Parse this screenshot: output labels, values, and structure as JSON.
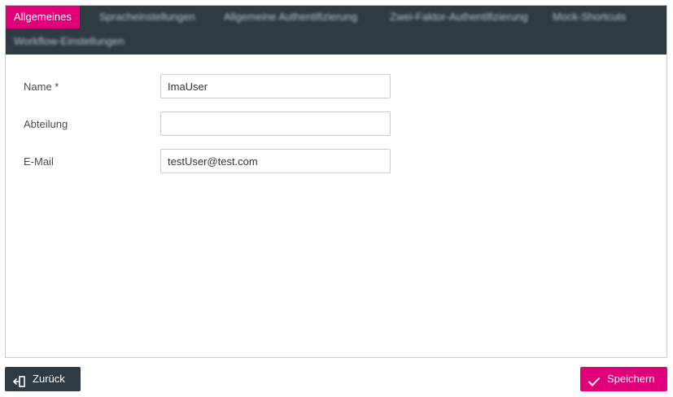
{
  "tabs": [
    {
      "label": "Allgemeines",
      "active": true
    },
    {
      "label": "Spracheinstellungen",
      "active": false
    },
    {
      "label": "Allgemeine Authentifizierung",
      "active": false
    },
    {
      "label": "Zwei-Faktor-Authentifizierung",
      "active": false
    },
    {
      "label": "Mock-Shortcuts",
      "active": false
    },
    {
      "label": "Workflow-Einstellungen",
      "active": false
    }
  ],
  "form": {
    "name_label": "Name *",
    "name_value": "ImaUser",
    "department_label": "Abteilung",
    "department_value": "",
    "email_label": "E-Mail",
    "email_value": "testUser@test.com"
  },
  "footer": {
    "back_label": "Zurück",
    "save_label": "Speichern"
  },
  "colors": {
    "accent": "#e2007a",
    "dark": "#2f3a43"
  },
  "icons": {
    "back": "exit-door-icon",
    "save": "checkmark-icon"
  }
}
